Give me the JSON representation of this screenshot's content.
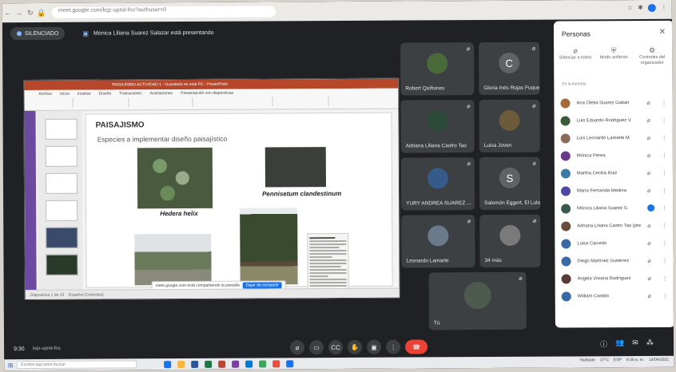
{
  "browser": {
    "url": "meet.google.com/kqz-upnd-fns?authuser=0",
    "nav_icons": [
      "back-icon",
      "forward-icon",
      "reload-icon",
      "lock-icon"
    ]
  },
  "meet_header": {
    "leave_chip_label": "SILENCIADO",
    "presenter_note": "Mónica Liliana Suarez Salazar está presentando"
  },
  "presentation": {
    "window_title": "PAISAJISMO ACTIVIDAD 1 - Guardado en este PC - PowerPoint",
    "ribbon_tabs": [
      "Archivo",
      "Inicio",
      "Insertar",
      "Diseño",
      "Transiciones",
      "Animaciones",
      "Presentación con diapositivas"
    ],
    "slide_title": "PAISAJISMO",
    "slide_subtitle": "Especies a implementar diseño paisajístico",
    "caption_1": "Hedera helix",
    "caption_2": "Pennisetum clandestinum",
    "status_left": "Diapositiva 1 de 15",
    "status_lang": "Español (Colombia)",
    "share_msg": "meet.google.com está compartiendo la pantalla",
    "share_btn": "Dejar de compartir"
  },
  "tiles": [
    {
      "name": "Robert Quiñones",
      "avatar_color": "#4a6a3a",
      "letter": ""
    },
    {
      "name": "Gloria Inés Rojas Fuquen",
      "avatar_color": "#5f6368",
      "letter": "C"
    },
    {
      "name": "Adriana Liliana Castro Tao",
      "avatar_color": "#2d4b3a",
      "letter": ""
    },
    {
      "name": "Luisa Joven",
      "avatar_color": "#6d5a3a",
      "letter": ""
    },
    {
      "name": "YURY ANDREA SUAREZ ...",
      "avatar_color": "#365a8a",
      "letter": ""
    },
    {
      "name": "Salomón Eggert, El Lulo",
      "avatar_color": "#5f6368",
      "letter": "S"
    },
    {
      "name": "Leonardo Lamarte",
      "avatar_color": "#6a7a8a",
      "letter": ""
    },
    {
      "name": "34 más",
      "avatar_color": "#7a7a7a",
      "letter": ""
    },
    {
      "name": "Tú",
      "avatar_color": "#4e5a4e",
      "letter": ""
    }
  ],
  "people_panel": {
    "title": "Personas",
    "tabs": [
      "Silenciar a todos",
      "Modo anfitrión",
      "Controles del organizador"
    ],
    "section_label": "En la llamada",
    "people": [
      {
        "name": "Ana Ofelia Suarez Gaban",
        "color": "#a56a3a",
        "mic": "mic-off-icon"
      },
      {
        "name": "Luis Eduardo Rodríguez V.",
        "color": "#3a5a3a",
        "mic": "mic-off-icon"
      },
      {
        "name": "Luis Leonardo Lamarte M.",
        "color": "#8a6a5a",
        "mic": "mic-off-icon"
      },
      {
        "name": "Mónica Perea",
        "color": "#6a3a8a",
        "mic": "mic-off-icon"
      },
      {
        "name": "Martha Cecilia Ruiz",
        "color": "#3a7aa5",
        "mic": "mic-off-icon"
      },
      {
        "name": "María Fernanda Medina",
        "color": "#4a4aa5",
        "mic": "mic-off-icon"
      },
      {
        "name": "Mónica Liliana Suarez S.",
        "color": "#3a5a4a",
        "mic": "speaking-icon"
      },
      {
        "name": "Adriana Liliana Castro Tao (presentador)",
        "color": "#6a4a3a",
        "mic": "mic-off-icon"
      },
      {
        "name": "Luisa Caicedo",
        "color": "#3a6aa5",
        "mic": "mic-off-icon"
      },
      {
        "name": "Diego Martínez Gutiérrez",
        "color": "#3a6aa5",
        "mic": "mic-off-icon"
      },
      {
        "name": "Angela Viviana Rodríguez",
        "color": "#5a3a3a",
        "mic": "mic-off-icon"
      },
      {
        "name": "William Castillo",
        "color": "#3a6aa5",
        "mic": "mic-off-icon"
      }
    ]
  },
  "controls": {
    "time": "9:30",
    "meeting_code": "kqz-upnd-fns",
    "buttons": [
      "mic-off-icon",
      "camera-off-icon",
      "captions-icon",
      "raise-hand-icon",
      "present-icon",
      "more-icon",
      "end-call-icon"
    ],
    "right_buttons": [
      "info-icon",
      "people-icon",
      "chat-icon",
      "activities-icon",
      "lock-icon"
    ]
  },
  "taskbar": {
    "search_placeholder": "Escribe aquí para buscar",
    "weather": "Nublado",
    "temp": "17°C",
    "lang": "ESP",
    "clock_time": "9:30 a. m.",
    "clock_date": "14/04/2021",
    "app_colors": [
      "#1a73e8",
      "#f6b73c",
      "#2b579a",
      "#217346",
      "#b7472a",
      "#7a3ea0",
      "#0078d4",
      "#3ba55c",
      "#e74c3c",
      "#1a73e8"
    ]
  },
  "colors": {
    "meet_bg": "#202124",
    "tile_bg": "#3c4043",
    "accent": "#8ab4f8",
    "end_call": "#ea4335",
    "ppt_brand": "#b7472a"
  }
}
